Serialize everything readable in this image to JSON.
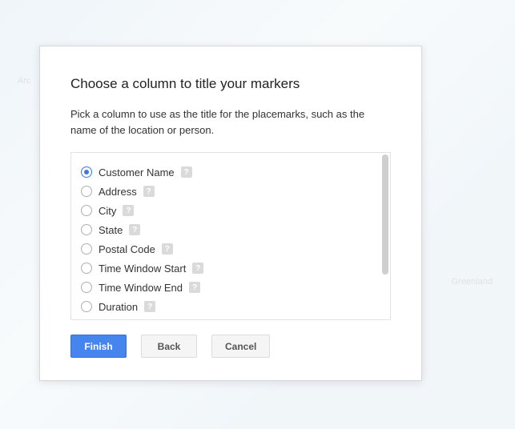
{
  "map": {
    "label_left": "Arc",
    "label_right": "Greenland"
  },
  "dialog": {
    "title": "Choose a column to title your markers",
    "description": "Pick a column to use as the title for the placemarks, such as the name of the location or person.",
    "options": [
      {
        "label": "Customer Name",
        "selected": true
      },
      {
        "label": "Address",
        "selected": false
      },
      {
        "label": "City",
        "selected": false
      },
      {
        "label": "State",
        "selected": false
      },
      {
        "label": "Postal Code",
        "selected": false
      },
      {
        "label": "Time Window Start",
        "selected": false
      },
      {
        "label": "Time Window End",
        "selected": false
      },
      {
        "label": "Duration",
        "selected": false
      }
    ],
    "help_glyph": "?",
    "buttons": {
      "finish": "Finish",
      "back": "Back",
      "cancel": "Cancel"
    }
  }
}
